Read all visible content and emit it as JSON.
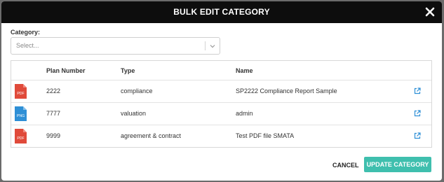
{
  "dialog": {
    "title": "BULK EDIT CATEGORY",
    "close_icon": "close-icon"
  },
  "category": {
    "label": "Category:",
    "placeholder": "Select...",
    "chevron_icon": "chevron-down-icon"
  },
  "table": {
    "headers": [
      "Plan Number",
      "Type",
      "Name"
    ],
    "rows": [
      {
        "file_type": "PDF",
        "plan_number": "2222",
        "type": "compliance",
        "name": "SP2222 Compliance Report Sample",
        "icon": "pdf-file-icon",
        "icon_color": "#e04a3a"
      },
      {
        "file_type": "PNG",
        "plan_number": "7777",
        "type": "valuation",
        "name": "admin",
        "icon": "png-file-icon",
        "icon_color": "#2e8fd6"
      },
      {
        "file_type": "PDF",
        "plan_number": "9999",
        "type": "agreement & contract",
        "name": "Test PDF file SMATA",
        "icon": "pdf-file-icon",
        "icon_color": "#e04a3a"
      }
    ],
    "link_icon": "external-link-icon",
    "link_color": "#2e8fd6"
  },
  "footer": {
    "cancel_label": "CANCEL",
    "update_label": "UPDATE CATEGORY",
    "update_color": "#3fbfae"
  }
}
